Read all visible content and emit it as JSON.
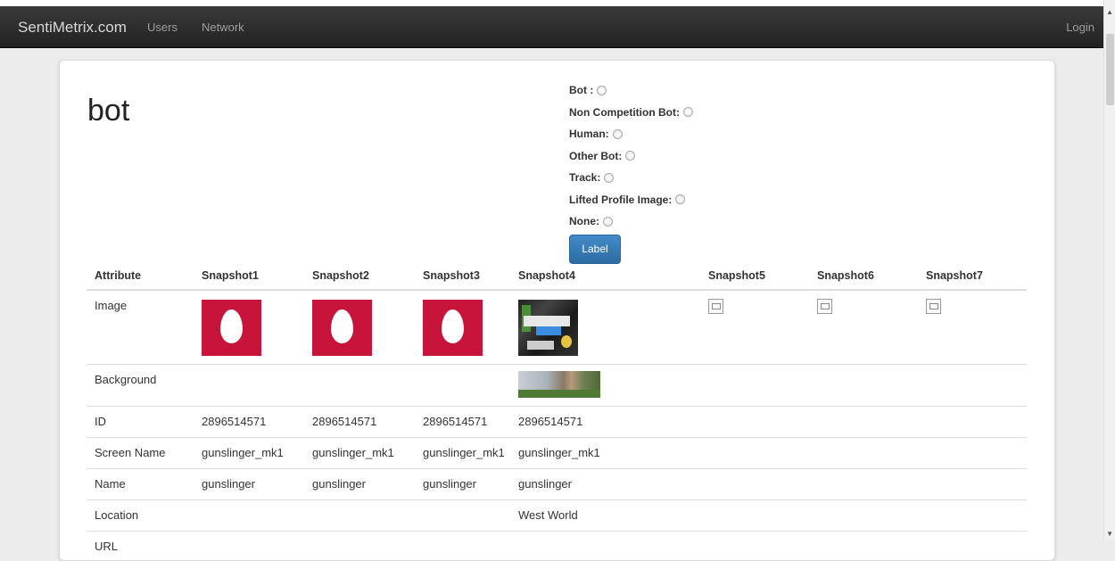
{
  "navbar": {
    "brand": "SentiMetrix.com",
    "links": [
      "Users",
      "Network"
    ],
    "login": "Login"
  },
  "page": {
    "title": "bot"
  },
  "labels": {
    "options": [
      "Bot :",
      "Non Competition Bot:",
      "Human:",
      "Other Bot:",
      "Track:",
      "Lifted Profile Image:",
      "None:"
    ],
    "button": "Label"
  },
  "table": {
    "headers": [
      "Attribute",
      "Snapshot1",
      "Snapshot2",
      "Snapshot3",
      "Snapshot4",
      "Snapshot5",
      "Snapshot6",
      "Snapshot7"
    ],
    "rows": [
      {
        "attr": "Image"
      },
      {
        "attr": "Background"
      },
      {
        "attr": "ID",
        "values": [
          "2896514571",
          "2896514571",
          "2896514571",
          "2896514571",
          "",
          "",
          ""
        ]
      },
      {
        "attr": "Screen Name",
        "values": [
          "gunslinger_mk1",
          "gunslinger_mk1",
          "gunslinger_mk1",
          "gunslinger_mk1",
          "",
          "",
          ""
        ]
      },
      {
        "attr": "Name",
        "values": [
          "gunslinger",
          "gunslinger",
          "gunslinger",
          "gunslinger",
          "",
          "",
          ""
        ]
      },
      {
        "attr": "Location",
        "values": [
          "",
          "",
          "",
          "West World",
          "",
          "",
          ""
        ]
      },
      {
        "attr": "URL"
      }
    ]
  },
  "colors": {
    "navbar": "#222222",
    "primary_button": "#428bca",
    "egg_background": "#c8143a"
  }
}
